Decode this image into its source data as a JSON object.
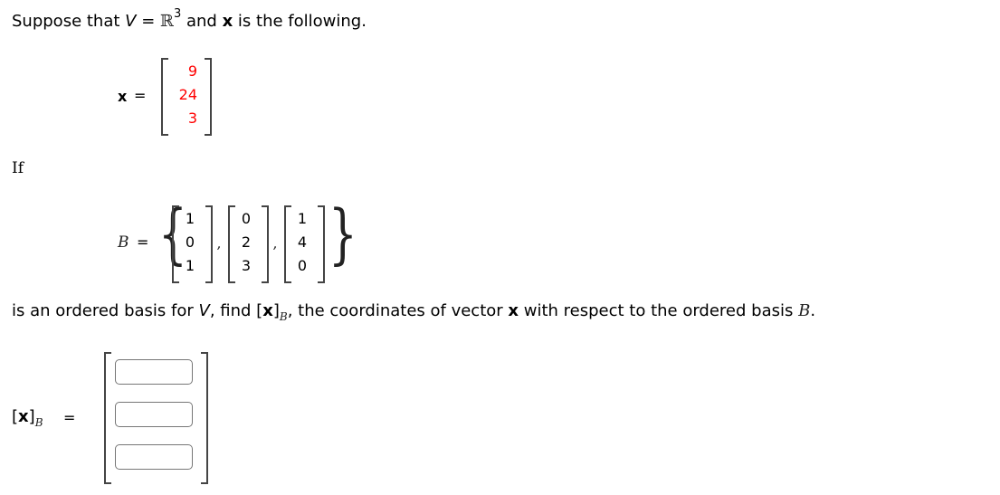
{
  "intro": {
    "prefix": "Suppose that ",
    "V": "V",
    "eq": " = ",
    "R": "ℝ",
    "exp": "3",
    "and": " and ",
    "x": "x",
    "suffix": " is the following."
  },
  "x_vector": {
    "label": "x",
    "eq": "=",
    "values": [
      "9",
      "24",
      "3"
    ],
    "value_color": "#ff0000"
  },
  "if_label": "If",
  "basis": {
    "label": "B",
    "eq": "=",
    "vectors": [
      [
        "1",
        "0",
        "1"
      ],
      [
        "0",
        "2",
        "3"
      ],
      [
        "1",
        "4",
        "0"
      ]
    ],
    "separator": ","
  },
  "question": {
    "part1": "is an ordered basis for ",
    "V": "V",
    "part2": ", find ",
    "lbr": "[",
    "x": "x",
    "rbr": "]",
    "sub": "B",
    "part3": ", the coordinates of vector ",
    "x2": "x",
    "part4": " with respect to the ordered basis ",
    "B": "B",
    "end": "."
  },
  "answer": {
    "lbr": "[",
    "x": "x",
    "rbr": "]",
    "sub": "B",
    "eq": "=",
    "inputs": [
      "",
      "",
      ""
    ]
  }
}
